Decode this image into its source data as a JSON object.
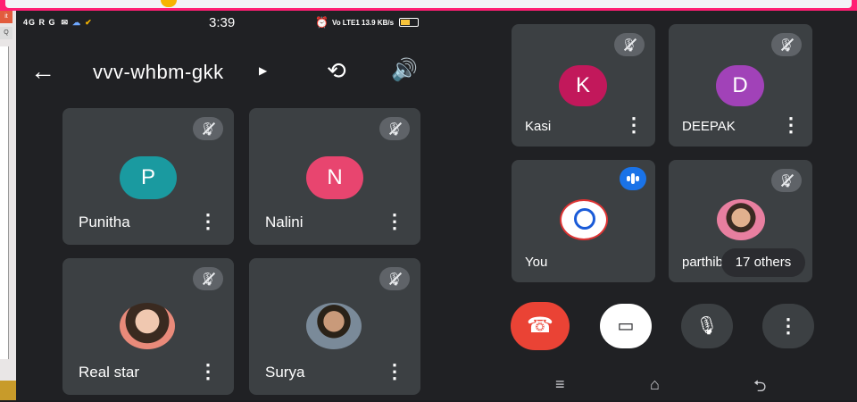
{
  "status_bar": {
    "left": "4G R G",
    "time": "3:39",
    "right": "Vo LTE1 13.9 KB/s"
  },
  "meeting": {
    "code": "vvv-whbm-gkk"
  },
  "left_tiles": [
    {
      "initial": "P",
      "name": "Punitha",
      "color": "#1a9aa0"
    },
    {
      "initial": "N",
      "name": "Nalini",
      "color": "#e8456f"
    },
    {
      "initial": "",
      "name": "Real star",
      "color": "#e9b8a8"
    },
    {
      "initial": "",
      "name": "Surya",
      "color": "#9a8d7b"
    }
  ],
  "right_tiles": [
    {
      "initial": "K",
      "name": "Kasi",
      "color": "#c2185b"
    },
    {
      "initial": "D",
      "name": "DEEPAK",
      "color": "#a142b8"
    },
    {
      "initial": "",
      "name": "You",
      "color": "#ffffff"
    },
    {
      "initial": "",
      "name": "parthib",
      "color": "#f0b0a0"
    }
  ],
  "others": {
    "label": "17 others"
  },
  "controls": {
    "end_color": "#ea4335",
    "camera_color": "#ffffff",
    "mic_color": "#3c4043",
    "more_color": "#3c4043"
  },
  "left_strip": {
    "tab1": "it",
    "tab2": "Q"
  }
}
